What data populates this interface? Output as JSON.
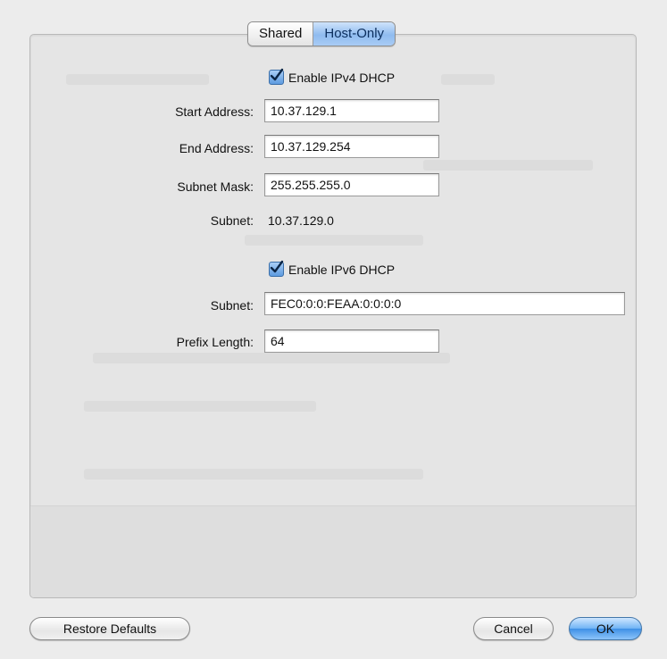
{
  "tabs": [
    {
      "label": "Shared",
      "active": false
    },
    {
      "label": "Host-Only",
      "active": true
    }
  ],
  "ipv4": {
    "enable_label": "Enable IPv4 DHCP",
    "enabled": true,
    "start_address_label": "Start Address:",
    "start_address_value": "10.37.129.1",
    "end_address_label": "End Address:",
    "end_address_value": "10.37.129.254",
    "subnet_mask_label": "Subnet Mask:",
    "subnet_mask_value": "255.255.255.0",
    "subnet_label": "Subnet:",
    "subnet_value": "10.37.129.0"
  },
  "ipv6": {
    "enable_label": "Enable IPv6 DHCP",
    "enabled": true,
    "subnet_label": "Subnet:",
    "subnet_value": "FEC0:0:0:FEAA:0:0:0:0",
    "prefix_length_label": "Prefix Length:",
    "prefix_length_value": "64"
  },
  "buttons": {
    "restore_defaults": "Restore Defaults",
    "cancel": "Cancel",
    "ok": "OK"
  },
  "colors": {
    "accent": "#5e9be0",
    "default_button": "#3f90e6"
  }
}
